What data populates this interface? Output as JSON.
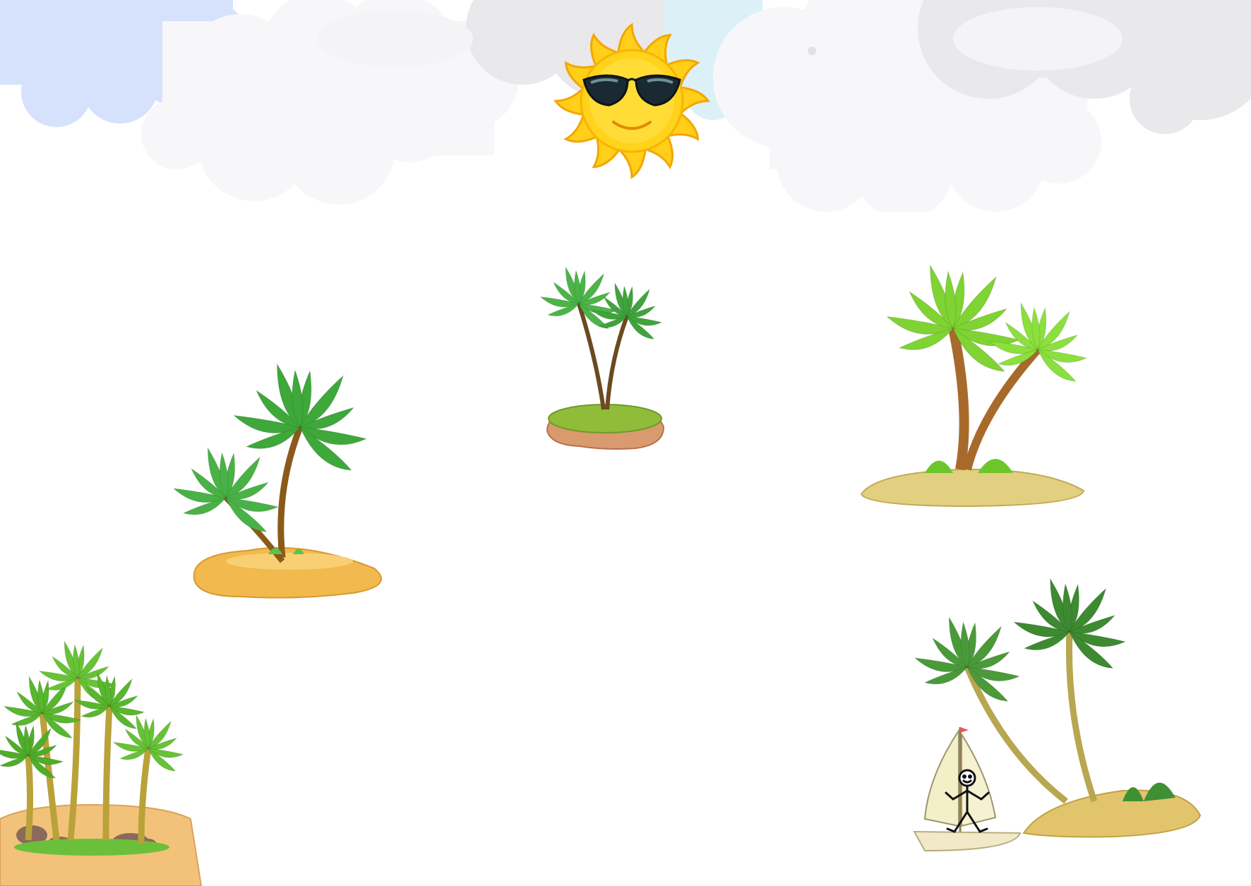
{
  "scene": {
    "background": "#ffffff",
    "sky_cloud_colors": {
      "blue": "#d6e2fb",
      "gray": "#e9e9ec",
      "white": "#f7f7f9",
      "sky": "#dcf1f7"
    },
    "sun": {
      "icon": "sun-with-sunglasses-icon",
      "color": "#ffd21c",
      "ray_color": "#ffcf1a"
    },
    "islands": [
      {
        "id": "island-left",
        "icon": "palm-island-icon",
        "sand_color": "#f2b94e",
        "leaf_color": "#3ea83b"
      },
      {
        "id": "island-center",
        "icon": "small-grass-island-icon",
        "dirt_color": "#d99b6e",
        "leaf_color": "#4bb548"
      },
      {
        "id": "island-right",
        "icon": "twin-palm-island-icon",
        "sand_color": "#e2cf80",
        "leaf_color": "#7fd332"
      },
      {
        "id": "island-corner",
        "icon": "palm-grove-island-icon",
        "sand_color": "#f3c27a",
        "leaf_color": "#58b72d"
      },
      {
        "id": "island-sailboat",
        "icon": "sailboat-island-icon",
        "sand_color": "#e2c46c",
        "leaf_color": "#4b9a3a"
      }
    ],
    "player": {
      "icon": "stick-figure-icon",
      "vehicle": "sailboat-icon",
      "sail_color": "#f3efc6"
    }
  }
}
